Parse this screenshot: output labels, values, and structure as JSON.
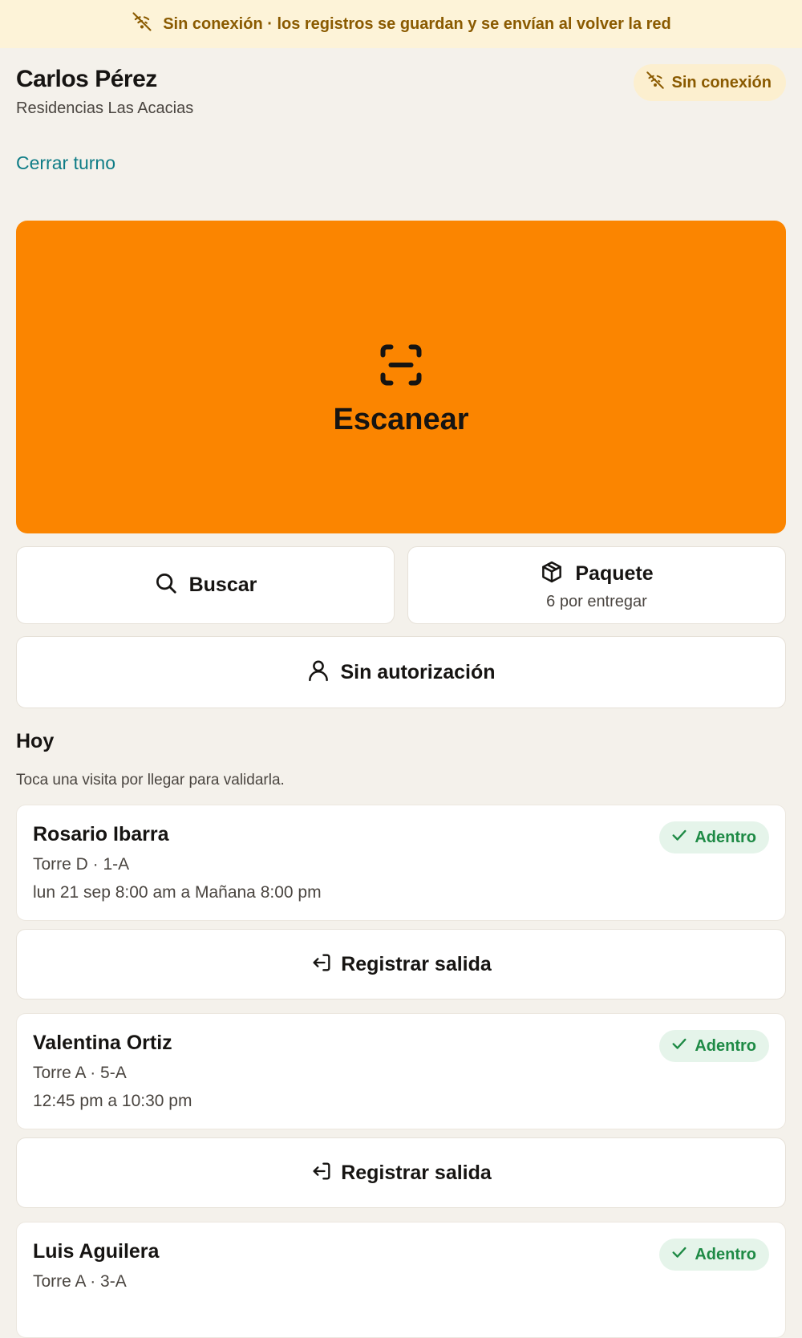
{
  "banner": {
    "icon": "wifi-off-icon",
    "text": "Sin conexión · los registros se guardan y se envían al volver la red"
  },
  "header": {
    "name": "Carlos Pérez",
    "site": "Residencias Las Acacias",
    "status_pill": "Sin conexión",
    "close_shift": "Cerrar turno"
  },
  "scan": {
    "icon": "scan-icon",
    "label": "Escanear"
  },
  "actions": {
    "search": {
      "icon": "search-icon",
      "label": "Buscar"
    },
    "package": {
      "icon": "package-icon",
      "label": "Paquete",
      "sub": "6 por entregar"
    },
    "no_auth": {
      "icon": "person-icon",
      "label": "Sin autorización"
    }
  },
  "today": {
    "title": "Hoy",
    "hint": "Toca una visita por llegar para validarla.",
    "visits": [
      {
        "name": "Rosario Ibarra",
        "unit": "Torre D · 1-A",
        "time": "lun 21 sep 8:00 am a Mañana 8:00 pm",
        "status": "Adentro",
        "exit_label": "Registrar salida"
      },
      {
        "name": "Valentina Ortiz",
        "unit": "Torre A · 5-A",
        "time": "12:45 pm a 10:30 pm",
        "status": "Adentro",
        "exit_label": "Registrar salida"
      },
      {
        "name": "Luis Aguilera",
        "unit": "Torre A · 3-A",
        "time": "",
        "status": "Adentro"
      }
    ]
  },
  "colors": {
    "background": "#F4F1EB",
    "accent_orange": "#FB8500",
    "link_teal": "#0E7C86",
    "offline_bg": "#FDF3D8",
    "offline_text": "#8A5A00",
    "status_green": "#1E8A45",
    "status_green_bg": "#E5F4EA"
  }
}
